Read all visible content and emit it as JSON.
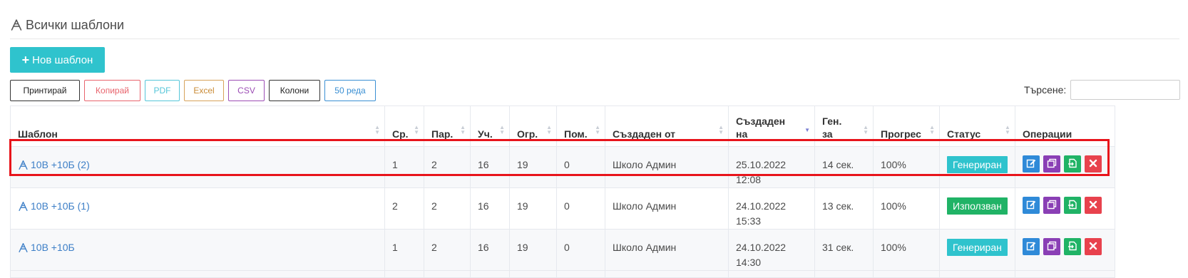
{
  "header": {
    "title": "Всички шаблони",
    "icon": "templates-icon"
  },
  "actions": {
    "new_template_label": "Нов шаблон"
  },
  "toolbar": {
    "print": "Принтирай",
    "copy": "Копирай",
    "pdf": "PDF",
    "excel": "Excel",
    "csv": "CSV",
    "columns": "Колони",
    "rows": "50 реда"
  },
  "search": {
    "label": "Търсене:",
    "value": ""
  },
  "table": {
    "columns": [
      "Шаблон",
      "Ср.",
      "Пар.",
      "Уч.",
      "Огр.",
      "Пом.",
      "Създаден от",
      "Създаден на",
      "Ген. за",
      "Прогрес",
      "Статус",
      "Операции"
    ],
    "sorted_column": "Създаден на",
    "sort_direction": "desc",
    "rows": [
      {
        "name": "10В +10Б (2)",
        "sr": "1",
        "par": "2",
        "uch": "16",
        "ogr": "19",
        "pom": "0",
        "created_by": "Школо Админ",
        "created_date": "25.10.2022",
        "created_time": "12:08",
        "gen_for": "14 сек.",
        "progress": "100%",
        "status": "Генериран",
        "status_type": "generated"
      },
      {
        "name": "10В +10Б (1)",
        "sr": "2",
        "par": "2",
        "uch": "16",
        "ogr": "19",
        "pom": "0",
        "created_by": "Школо Админ",
        "created_date": "24.10.2022",
        "created_time": "15:33",
        "gen_for": "13 сек.",
        "progress": "100%",
        "status": "Използван",
        "status_type": "used"
      },
      {
        "name": "10В +10Б",
        "sr": "1",
        "par": "2",
        "uch": "16",
        "ogr": "19",
        "pom": "0",
        "created_by": "Школо Админ",
        "created_date": "24.10.2022",
        "created_time": "14:30",
        "gen_for": "31 сек.",
        "progress": "100%",
        "status": "Генериран",
        "status_type": "generated"
      }
    ]
  },
  "colors": {
    "accent": "#2fc3cd",
    "link": "#3d7fc7",
    "status_generated": "#2fc3cd",
    "status_used": "#20b366",
    "edit": "#2f8ad8",
    "duplicate": "#8a3fb5",
    "export": "#20b366",
    "delete": "#e8424d",
    "highlight": "#e8141b"
  },
  "icons": {
    "operations": [
      "edit-icon",
      "duplicate-icon",
      "export-icon",
      "delete-icon"
    ]
  }
}
